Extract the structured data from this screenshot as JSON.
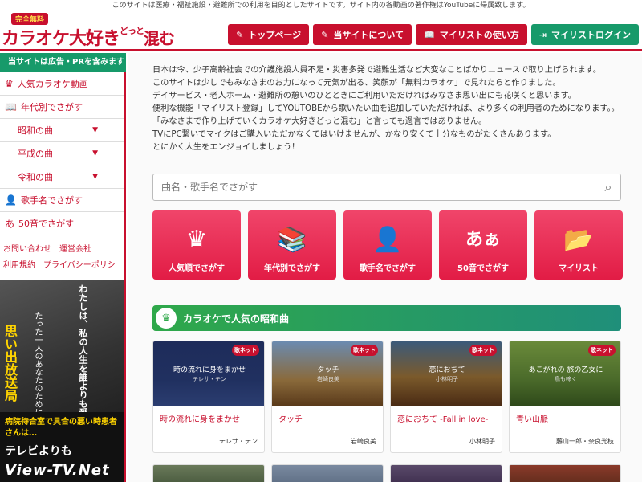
{
  "notice": "このサイトは医療・福祉施設・避難所での利用を目的としたサイトです。サイト内の各動画の著作権はYouTubeに帰属致します。",
  "logo": {
    "badge": "完全無料",
    "main": "カラオケ大好き",
    "sub1": "どっと",
    "sub2": "混む"
  },
  "nav": [
    {
      "label": "トップページ",
      "icon": "pen-icon"
    },
    {
      "label": "当サイトについて",
      "icon": "pen-icon"
    },
    {
      "label": "マイリストの使い方",
      "icon": "book-icon"
    },
    {
      "label": "マイリストログイン",
      "icon": "login-icon"
    }
  ],
  "sidebar": {
    "ad_note": "当サイトは広告・PRを含みます",
    "items": [
      {
        "label": "人気カラオケ動画",
        "icon": "crown-icon"
      },
      {
        "label": "年代別でさがす",
        "icon": "book-icon"
      },
      {
        "label": "昭和の曲"
      },
      {
        "label": "平成の曲"
      },
      {
        "label": "令和の曲"
      },
      {
        "label": "歌手名でさがす",
        "icon": "person-icon"
      },
      {
        "label": "50音でさがす",
        "icon": "kana-icon"
      }
    ],
    "links": [
      "お問い合わせ",
      "運営会社",
      "利用規約",
      "プライバシーポリシー"
    ],
    "ad": {
      "vtext1": "わたしは、私の人生を誰よりも愛している",
      "vtext2": "たった一人のあなたのために",
      "yellow": "思い出放送局",
      "b1": "病院待合室で具合の悪い時患者さんは…",
      "b2": "テレビよりも",
      "b3": "View-TV.Net"
    }
  },
  "intro": [
    "日本は今、少子高齢社会での介護施設人員不足・災害多発で避難生活など大変なことばかりニュースで取り上げられます。",
    "このサイトは少しでもみなさまのお力になって元気が出る、笑顔が「無料カラオケ」で見れたらと作りました。",
    "デイサービス・老人ホーム・避難所の憩いのひとときにご利用いただければみなさま思い出にも花咲くと思います。",
    "便利な機能「マイリスト登録」してYOUTOBEから歌いたい曲を追加していただければ、より多くの利用者のためになります。。",
    "「みなさまで作り上げていくカラオケ大好きどっと混む」と言っても過言ではありません。",
    "TVにPC繋いでマイクはご購入いただかなくてはいけませんが、かなり安くて十分なものがたくさんあります。",
    "とにかく人生をエンジョイしましょう！"
  ],
  "search": {
    "placeholder": "曲名・歌手名でさがす"
  },
  "categories": [
    {
      "label": "人気順でさがす",
      "icon": "crown-icon",
      "glyph": "♛"
    },
    {
      "label": "年代別でさがす",
      "icon": "books-icon",
      "glyph": "📚"
    },
    {
      "label": "歌手名でさがす",
      "icon": "person-icon",
      "glyph": "👤"
    },
    {
      "label": "50音でさがす",
      "icon": "kana-icon",
      "glyph": "あぁ"
    },
    {
      "label": "マイリスト",
      "icon": "folder-icon",
      "glyph": "📂"
    }
  ],
  "section": {
    "title": "カラオケで人気の昭和曲"
  },
  "songs": [
    {
      "title": "時の流れに身をまかせ",
      "artist": "テレサ・テン",
      "thumb_line1": "時の流れに身をまかせ",
      "thumb_line2": "テレサ・テン"
    },
    {
      "title": "タッチ",
      "artist": "岩崎良美",
      "thumb_line1": "タッチ",
      "thumb_line2": "岩崎良美"
    },
    {
      "title": "恋におちて -Fall in love-",
      "artist": "小林明子",
      "thumb_line1": "恋におちて",
      "thumb_line2": "小林明子"
    },
    {
      "title": "青い山脈",
      "artist": "藤山一郎・奈良光枝",
      "thumb_line1": "あこがれの 旅の乙女に",
      "thumb_line2": "鳥も啼く"
    }
  ],
  "thumb_logo": "歌ネット"
}
